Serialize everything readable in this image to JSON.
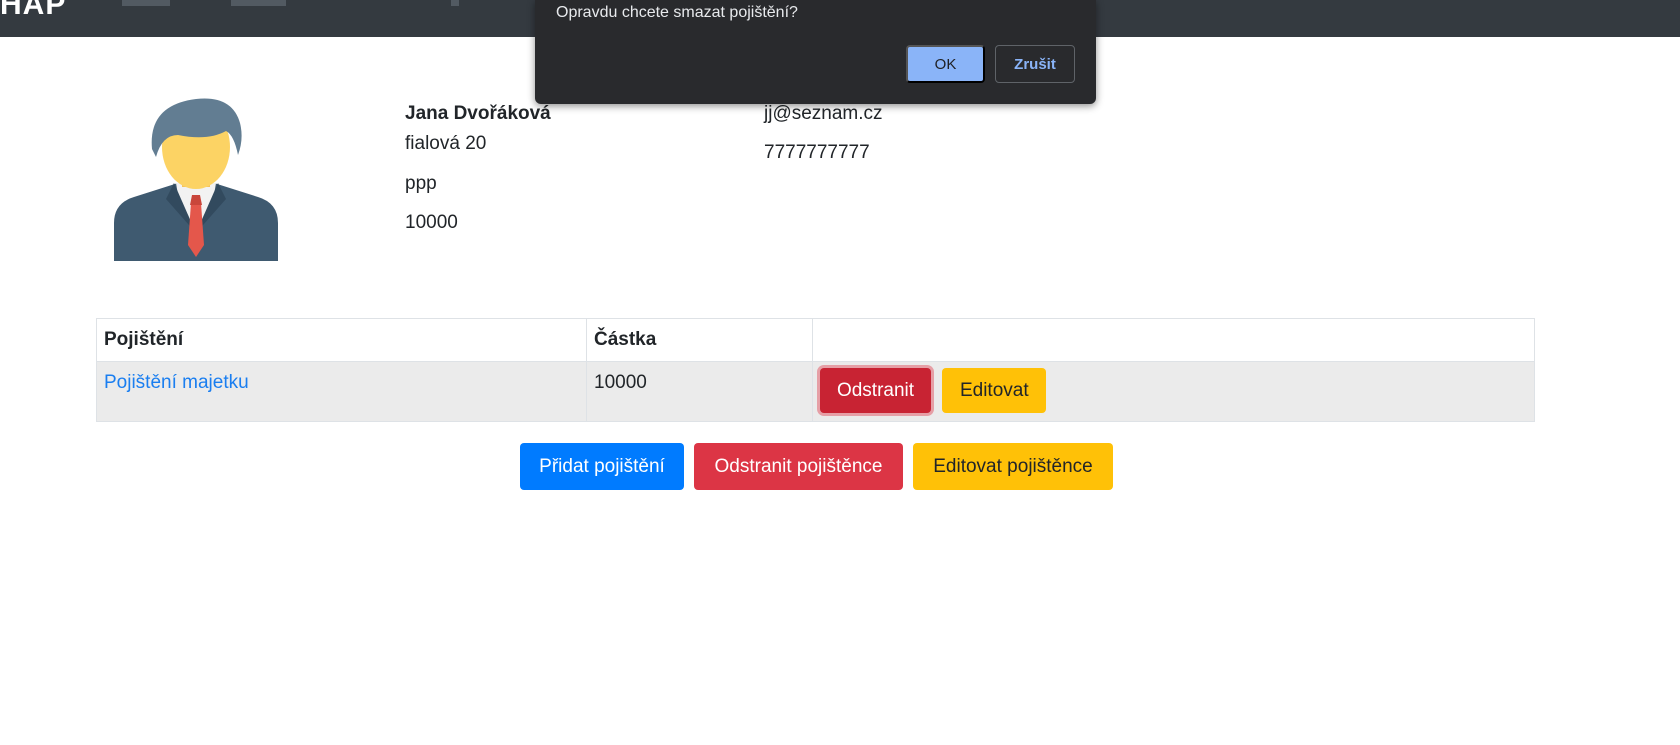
{
  "navbar": {
    "brand": "HAP"
  },
  "dialog": {
    "message": "Opravdu chcete smazat pojištění?",
    "ok_label": "OK",
    "cancel_label": "Zrušit"
  },
  "person": {
    "name": "Jana Dvořáková",
    "street": "fialová 20",
    "city": "ppp",
    "zip": "10000",
    "email": "jj@seznam.cz",
    "phone": "7777777777"
  },
  "table": {
    "headers": [
      "Pojištění",
      "Částka",
      ""
    ],
    "rows": [
      {
        "name": "Pojištění majetku",
        "amount": "10000",
        "delete_label": "Odstranit",
        "edit_label": "Editovat"
      }
    ]
  },
  "actions": {
    "add_label": "Přidat pojištění",
    "delete_label": "Odstranit pojištěnce",
    "edit_label": "Editovat pojištěnce"
  },
  "colors": {
    "navbar": "#343a40",
    "primary": "#007bff",
    "danger": "#dc3545",
    "warning": "#ffc107",
    "link": "#1a7ef0"
  }
}
